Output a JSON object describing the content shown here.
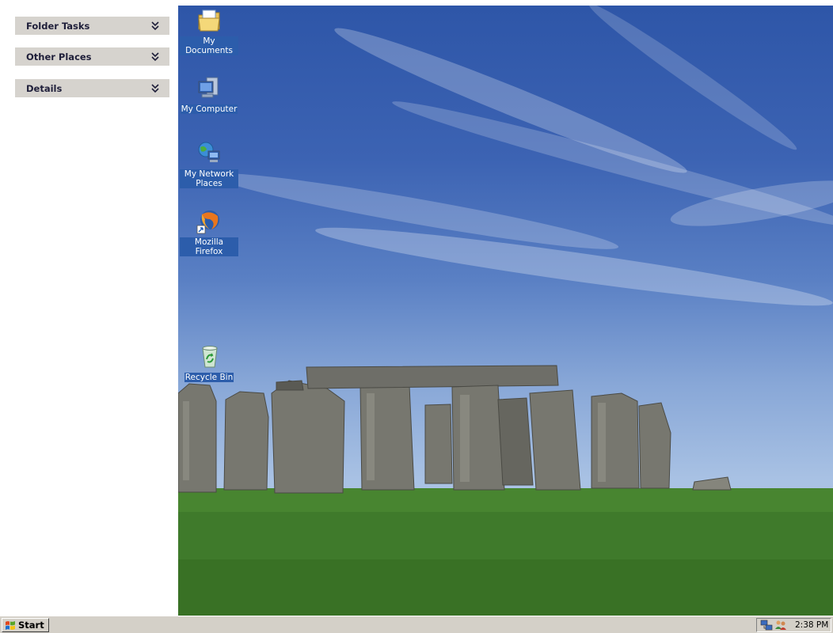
{
  "task_pane": {
    "sections": [
      {
        "label": "Folder Tasks",
        "icon": "chevron-double-down-icon"
      },
      {
        "label": "Other Places",
        "icon": "chevron-double-down-icon"
      },
      {
        "label": "Details",
        "icon": "chevron-double-down-icon"
      }
    ]
  },
  "desktop": {
    "icons": [
      {
        "label": "My Documents",
        "icon": "my-documents-icon"
      },
      {
        "label": "My Computer",
        "icon": "my-computer-icon"
      },
      {
        "label": "My Network Places",
        "icon": "my-network-places-icon"
      },
      {
        "label": "Mozilla Firefox",
        "icon": "firefox-icon"
      },
      {
        "label": "Recycle Bin",
        "icon": "recycle-bin-icon"
      }
    ]
  },
  "taskbar": {
    "start_label": "Start",
    "clock": "2:38 PM",
    "tray_icons": [
      "network-icon",
      "users-icon"
    ]
  },
  "colors": {
    "taskbar_bg": "#d4d0c8",
    "task_header_bg": "#d6d3ce",
    "icon_caption_bg": "#2c5dab",
    "sky_top": "#2e56a8",
    "grass": "#3f7a2b"
  }
}
